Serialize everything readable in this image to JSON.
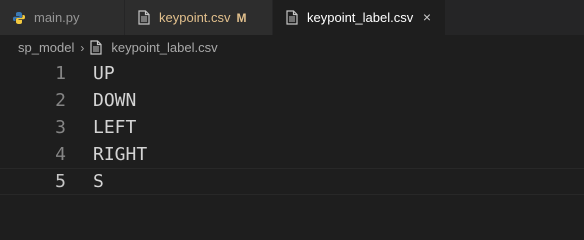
{
  "tabs": [
    {
      "label": "main.py",
      "icon": "python-icon",
      "active": false,
      "modified": false
    },
    {
      "label": "keypoint.csv",
      "icon": "file-icon",
      "active": false,
      "modified": true,
      "modified_label": "M"
    },
    {
      "label": "keypoint_label.csv",
      "icon": "file-icon",
      "active": true,
      "modified": false,
      "close_label": "×"
    }
  ],
  "breadcrumb": {
    "folder": "sp_model",
    "separator": "›",
    "file": "keypoint_label.csv"
  },
  "editor": {
    "lines": [
      {
        "number": "1",
        "text": "UP"
      },
      {
        "number": "2",
        "text": "DOWN"
      },
      {
        "number": "3",
        "text": "LEFT"
      },
      {
        "number": "4",
        "text": "RIGHT"
      },
      {
        "number": "5",
        "text": "S"
      }
    ],
    "current_line": 5
  },
  "colors": {
    "background": "#1e1e1e",
    "tabbar": "#252526",
    "modified": "#e2c08d",
    "line_number": "#858585"
  }
}
